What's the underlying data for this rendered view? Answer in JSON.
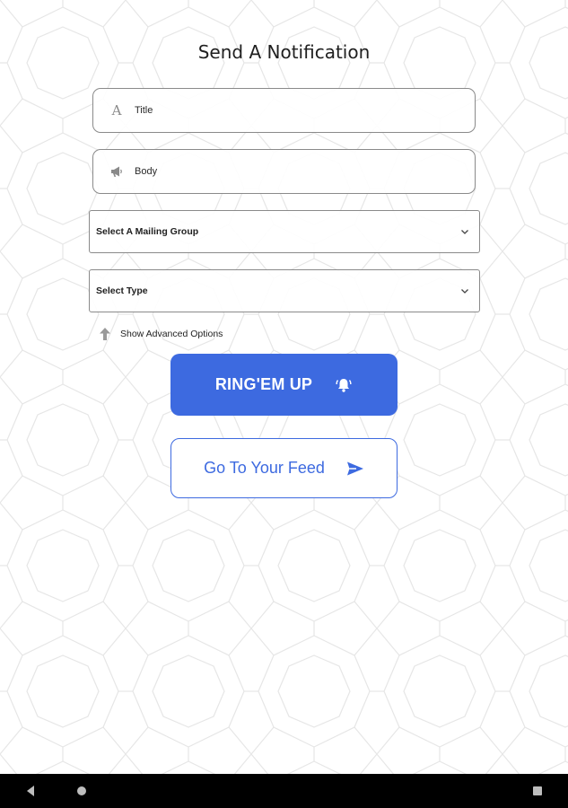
{
  "page": {
    "title": "Send A Notification"
  },
  "form": {
    "title_field": {
      "placeholder": "Title",
      "value": "",
      "icon": "text-format-icon"
    },
    "body_field": {
      "placeholder": "Body",
      "value": "",
      "icon": "megaphone-icon"
    },
    "mailing_group_select": {
      "label": "Select A Mailing Group",
      "icon": "chevron-down-icon"
    },
    "type_select": {
      "label": "Select Type",
      "icon": "chevron-down-icon"
    },
    "advanced_toggle": {
      "label": "Show Advanced Options",
      "icon": "arrow-up-icon"
    }
  },
  "actions": {
    "ring_button": {
      "label": "RING'EM UP",
      "icon": "alarm-bell-icon"
    },
    "feed_button": {
      "label": "Go To Your Feed",
      "icon": "send-icon"
    }
  },
  "system_nav": {
    "back": "back-icon",
    "home": "home-icon",
    "recents": "recents-icon"
  },
  "colors": {
    "accent": "#3d6ae0",
    "border": "#8a8a8a",
    "pattern": "#e6e6e6",
    "navbar": "#000000"
  }
}
